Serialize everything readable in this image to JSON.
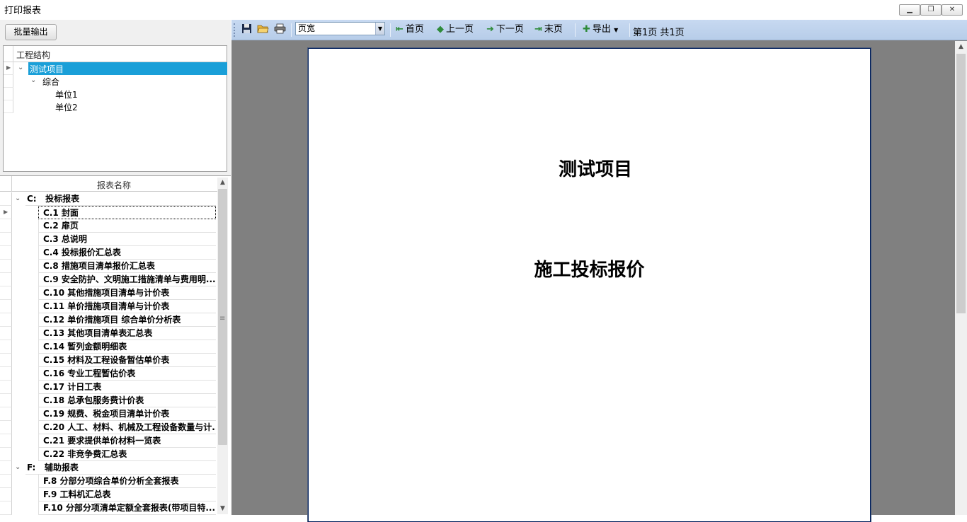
{
  "window": {
    "title": "打印报表",
    "minimize_icon": "minimize-icon",
    "restore_icon": "restore-icon",
    "close_icon": "close-icon"
  },
  "left": {
    "batch_button": "批量输出",
    "tree": {
      "header": "工程结构",
      "items": [
        {
          "label": "测试项目",
          "selected": true
        },
        {
          "label": "综合"
        },
        {
          "label": "单位1"
        },
        {
          "label": "单位2"
        }
      ]
    },
    "reports": {
      "header": "报表名称",
      "groups": [
        {
          "code": "C:",
          "label": "投标报表"
        },
        {
          "code": "F:",
          "label": "辅助报表"
        }
      ],
      "rows": [
        "C.1 封面",
        "C.2 扉页",
        "C.3 总说明",
        "C.4 投标报价汇总表",
        "C.8 措施项目清单报价汇总表",
        "C.9 安全防护、文明施工措施清单与费用明...",
        "C.10 其他措施项目清单与计价表",
        "C.11 单价措施项目清单与计价表",
        "C.12 单价措施项目 综合单价分析表",
        "C.13 其他项目清单表汇总表",
        "C.14 暂列金额明细表",
        "C.15 材料及工程设备暂估单价表",
        "C.16 专业工程暂估价表",
        "C.17 计日工表",
        "C.18 总承包服务费计价表",
        "C.19 规费、税金项目清单计价表",
        "C.20 人工、材料、机械及工程设备数量与计...",
        "C.21 要求提供单价材料一览表",
        "C.22 非竞争费汇总表"
      ],
      "f_rows": [
        "F.8 分部分项综合单价分析全套报表",
        "F.9 工料机汇总表",
        "F.10 分部分项清单定额全套报表(带项目特..."
      ]
    }
  },
  "toolbar": {
    "save_icon": "save-icon",
    "open_icon": "open-folder-icon",
    "print_icon": "printer-icon",
    "zoom_value": "页宽",
    "first_page": "首页",
    "prev_page": "上一页",
    "next_page": "下一页",
    "last_page": "末页",
    "export": "导出",
    "page_info": "第1页 共1页"
  },
  "preview": {
    "line1": "测试项目",
    "line2": "施工投标报价"
  }
}
